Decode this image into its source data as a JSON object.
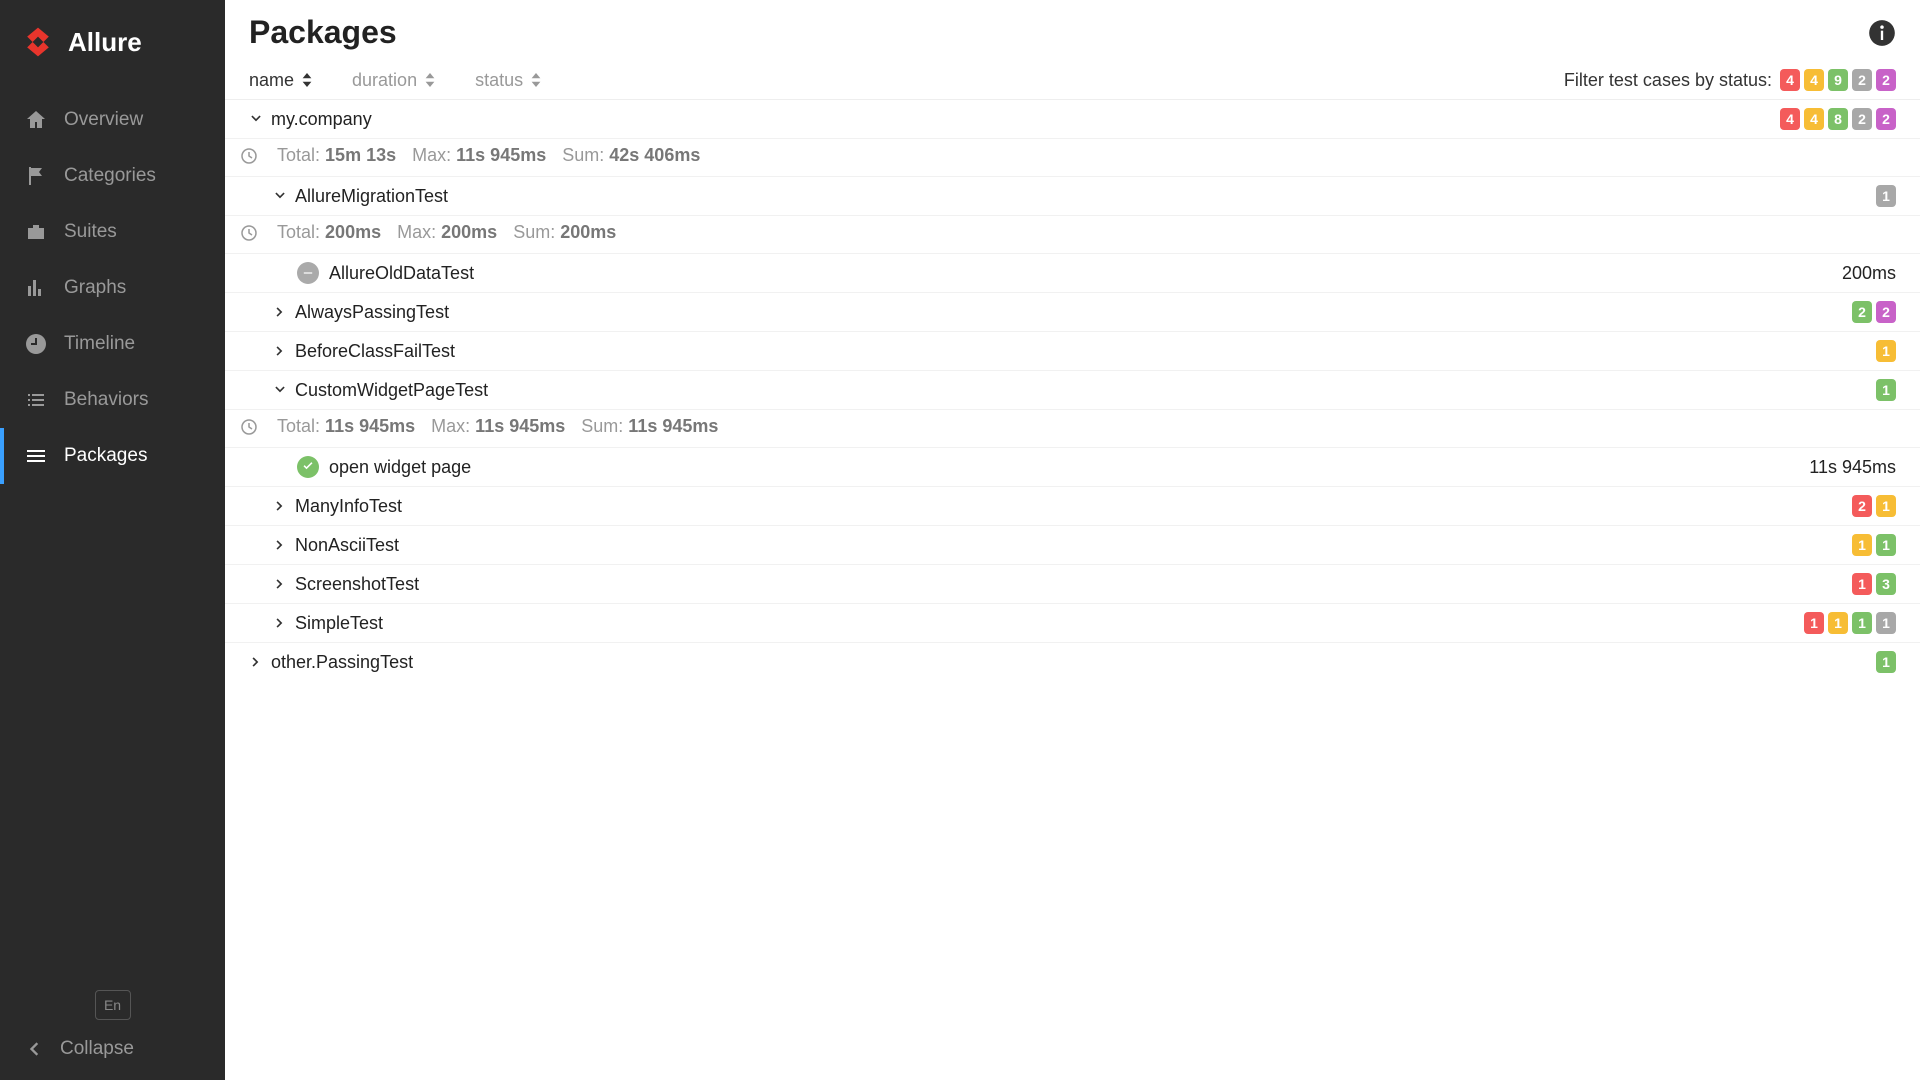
{
  "brand": "Allure",
  "lang": "En",
  "nav": {
    "overview": "Overview",
    "categories": "Categories",
    "suites": "Suites",
    "graphs": "Graphs",
    "timeline": "Timeline",
    "behaviors": "Behaviors",
    "packages": "Packages",
    "collapse": "Collapse"
  },
  "page": {
    "title": "Packages"
  },
  "sorters": {
    "name": "name",
    "duration": "duration",
    "status": "status"
  },
  "filter": {
    "label": "Filter test cases by status:",
    "counts": {
      "failed": "4",
      "broken": "4",
      "passed": "9",
      "skipped": "2",
      "unknown": "2"
    }
  },
  "tree": {
    "myCompany": {
      "name": "my.company",
      "counts": {
        "failed": "4",
        "broken": "4",
        "passed": "8",
        "skipped": "2",
        "unknown": "2"
      },
      "stats": {
        "totalLabel": "Total:",
        "total": "15m 13s",
        "maxLabel": "Max:",
        "max": "11s 945ms",
        "sumLabel": "Sum:",
        "sum": "42s 406ms"
      },
      "children": {
        "allureMigration": {
          "name": "AllureMigrationTest",
          "counts": {
            "unknown": "1"
          },
          "stats": {
            "totalLabel": "Total:",
            "total": "200ms",
            "maxLabel": "Max:",
            "max": "200ms",
            "sumLabel": "Sum:",
            "sum": "200ms"
          },
          "tests": {
            "oldData": {
              "name": "AllureOldDataTest",
              "duration": "200ms"
            }
          }
        },
        "alwaysPassing": {
          "name": "AlwaysPassingTest",
          "counts": {
            "passed": "2",
            "unknown": "2"
          }
        },
        "beforeClassFail": {
          "name": "BeforeClassFailTest",
          "counts": {
            "broken": "1"
          }
        },
        "customWidget": {
          "name": "CustomWidgetPageTest",
          "counts": {
            "passed": "1"
          },
          "stats": {
            "totalLabel": "Total:",
            "total": "11s 945ms",
            "maxLabel": "Max:",
            "max": "11s 945ms",
            "sumLabel": "Sum:",
            "sum": "11s 945ms"
          },
          "tests": {
            "openWidget": {
              "name": "open widget page",
              "duration": "11s 945ms"
            }
          }
        },
        "manyInfo": {
          "name": "ManyInfoTest",
          "counts": {
            "failed": "2",
            "broken": "1"
          }
        },
        "nonAscii": {
          "name": "NonAsciiTest",
          "counts": {
            "broken": "1",
            "passed": "1"
          }
        },
        "screenshot": {
          "name": "ScreenshotTest",
          "counts": {
            "failed": "1",
            "passed": "3"
          }
        },
        "simple": {
          "name": "SimpleTest",
          "counts": {
            "failed": "1",
            "broken": "1",
            "passed": "1",
            "unknown": "1"
          }
        }
      }
    },
    "otherPassing": {
      "name": "other.PassingTest",
      "counts": {
        "passed": "1"
      }
    }
  }
}
